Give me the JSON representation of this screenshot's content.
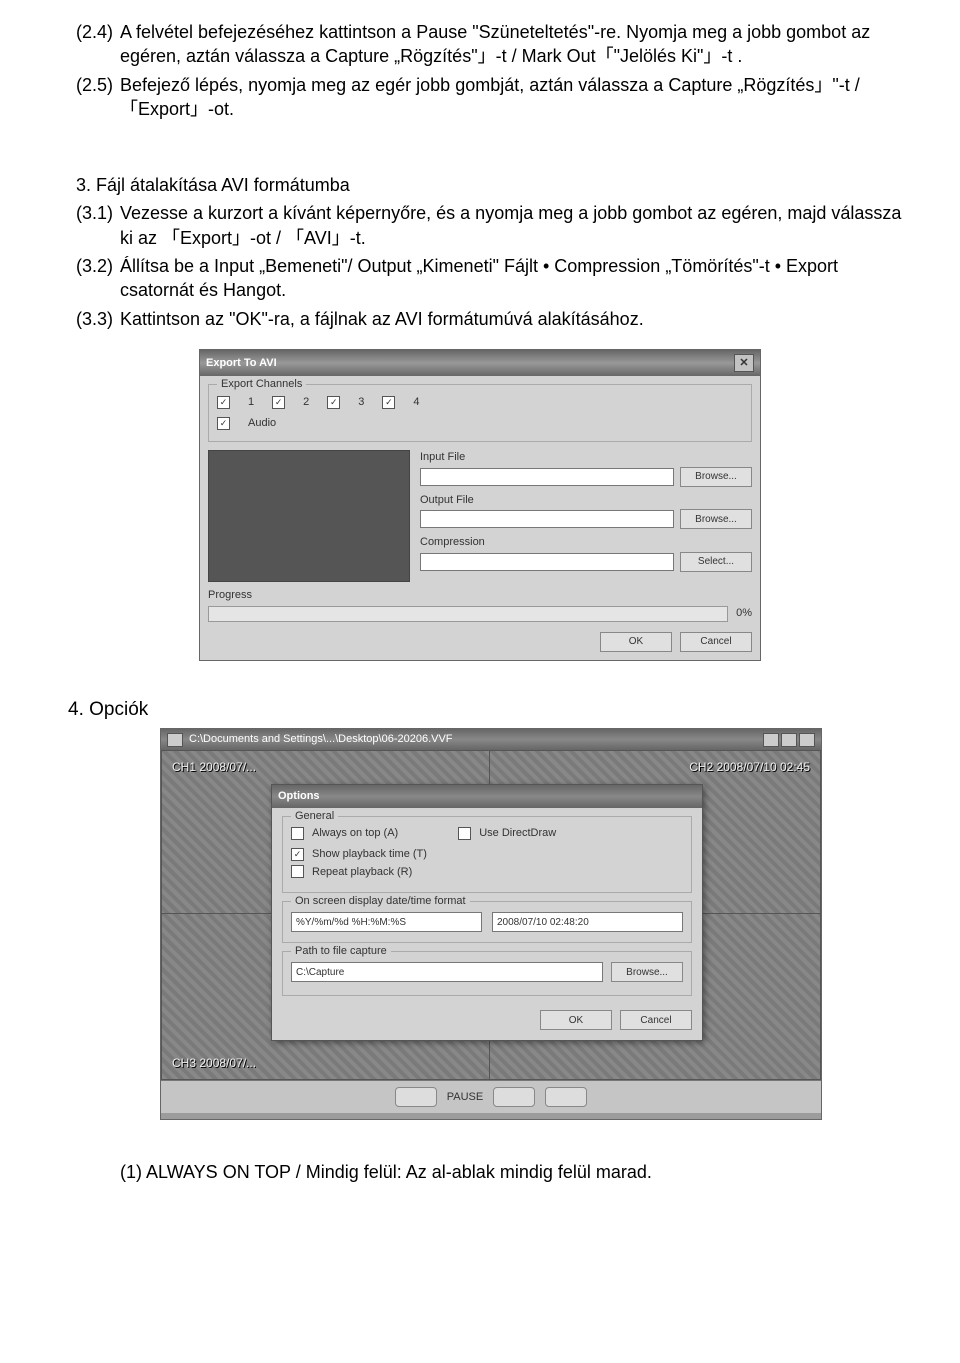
{
  "instr": {
    "s2_4_num": "(2.4)",
    "s2_4": "A felvétel befejezéséhez kattintson a Pause \"Szüneteltetés\"-re. Nyomja meg a jobb gombot az egéren, aztán válassza a Capture „Rögzítés\"」-t  / Mark Out「\"Jelölés Ki\"」-t .",
    "s2_5_num": "(2.5)",
    "s2_5": "Befejező lépés, nyomja meg az egér jobb gombját, aztán válassza a  Capture „Rögzítés」\"-t  / 「Export」-ot.",
    "sec3_title": "3.   Fájl átalakítása AVI formátumba",
    "s3_1_num": "(3.1)",
    "s3_1": "Vezesse a kurzort a kívánt képernyőre, és a nyomja meg a jobb gombot az egéren, majd válassza ki az 「Export」-ot  / 「AVI」-t.",
    "s3_2_num": "(3.2)",
    "s3_2": "Állítsa be a Input „Bemeneti\"/ Output „Kimeneti\" Fájlt • Compression „Tömörítés\"-t • Export csatornát és Hangot.",
    "s3_3_num": "(3.3)",
    "s3_3": "Kattintson az \"OK\"-ra, a fájlnak az AVI formátumúvá alakításához."
  },
  "dialog1": {
    "title": "Export To AVI",
    "close": "✕",
    "export_channels": "Export Channels",
    "ch1": "1",
    "ch2": "2",
    "ch3": "3",
    "ch4": "4",
    "audio": "Audio",
    "input_file": "Input File",
    "output_file": "Output File",
    "compression": "Compression",
    "browse": "Browse...",
    "select": "Select...",
    "progress": "Progress",
    "pct": "0%",
    "ok": "OK",
    "cancel": "Cancel"
  },
  "sec4": {
    "title": "4.   Opciók",
    "player_path": "C:\\Documents and Settings\\...\\Desktop\\06-20206.VVF",
    "cam_tl": "CH1 2008/07/...",
    "cam_tr": "CH2 2008/07/10 02:45",
    "cam_bl": "CH3 2008/07/...",
    "pause": "PAUSE"
  },
  "options": {
    "title": "Options",
    "general": "General",
    "always_top": "Always on top (A)",
    "use_dd": "Use DirectDraw",
    "show_pb_time": "Show playback time (T)",
    "repeat": "Repeat playback (R)",
    "osd_group": "On screen display date/time format",
    "osd_fmt": "%Y/%m/%d %H:%M:%S",
    "osd_sample": "2008/07/10 02:48:20",
    "capture_group": "Path to file capture",
    "capture_path": "C:\\Capture",
    "browse": "Browse...",
    "ok": "OK",
    "cancel": "Cancel"
  },
  "footer": "(1)   ALWAYS ON TOP / Mindig felül: Az al-ablak mindig felül marad."
}
